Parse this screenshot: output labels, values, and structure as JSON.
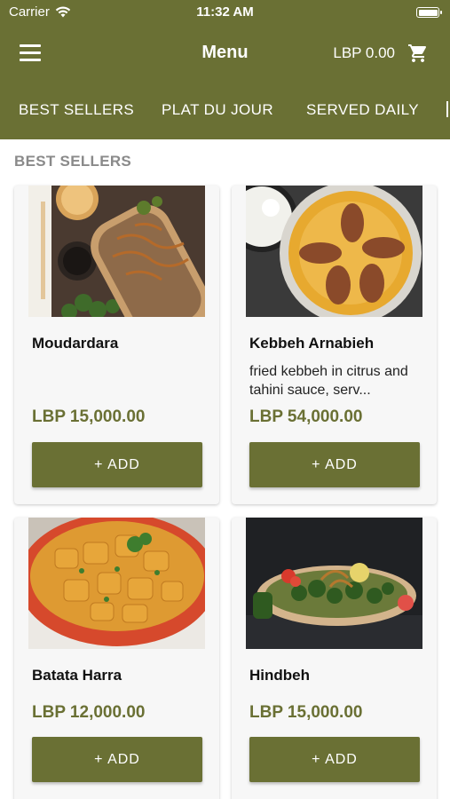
{
  "status_bar": {
    "carrier": "Carrier",
    "time": "11:32 AM"
  },
  "toolbar": {
    "title": "Menu",
    "cart_total": "LBP 0.00"
  },
  "tabs": [
    {
      "label": "BEST SELLERS"
    },
    {
      "label": "PLAT DU JOUR"
    },
    {
      "label": "SERVED DAILY"
    }
  ],
  "section": {
    "title": "BEST SELLERS"
  },
  "items": [
    {
      "name": "Moudardara",
      "description": "",
      "price": "LBP 15,000.00",
      "add_label": "+ ADD"
    },
    {
      "name": "Kebbeh Arnabieh",
      "description": "fried kebbeh in citrus and tahini sauce, serv...",
      "price": "LBP 54,000.00",
      "add_label": "+ ADD"
    },
    {
      "name": "Batata Harra",
      "description": "",
      "price": "LBP 12,000.00",
      "add_label": "+ ADD"
    },
    {
      "name": "Hindbeh",
      "description": "",
      "price": "LBP 15,000.00",
      "add_label": "+ ADD"
    }
  ],
  "colors": {
    "brand": "#6a7034",
    "background": "#ffffff",
    "card": "#f7f7f7"
  },
  "icons": {
    "menu": "hamburger-icon",
    "cart": "cart-icon",
    "wifi": "wifi-icon",
    "battery": "battery-icon"
  }
}
